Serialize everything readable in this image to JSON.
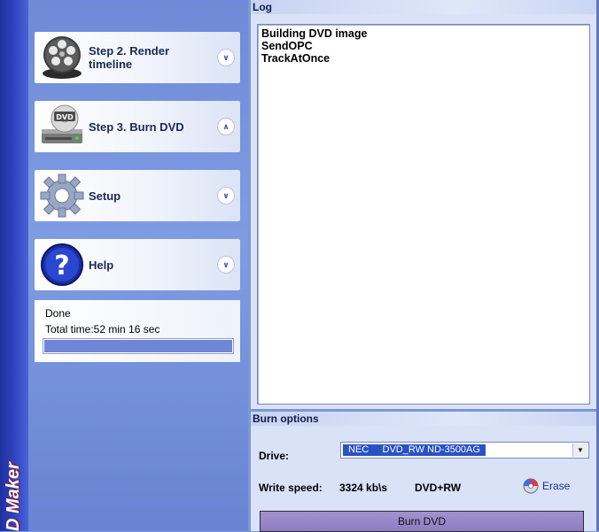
{
  "brand": {
    "text": "D Maker"
  },
  "steps": [
    {
      "label": "Step 2. Render timeline",
      "icon": "film-reel-icon",
      "state": "collapsed"
    },
    {
      "label": "Step 3. Burn DVD",
      "icon": "dvd-drive-icon",
      "state": "expanded",
      "icon_text": "DVD"
    },
    {
      "label": "Setup",
      "icon": "gear-icon",
      "state": "collapsed"
    },
    {
      "label": "Help",
      "icon": "help-icon",
      "state": "collapsed",
      "icon_text": "?"
    }
  ],
  "status": {
    "state": "Done",
    "total_time": "Total time:52 min 16 sec",
    "progress": 1.0
  },
  "log": {
    "title": "Log",
    "lines": [
      "Building DVD image",
      "SendOPC",
      "TrackAtOnce"
    ]
  },
  "burn_options": {
    "title": "Burn options",
    "drive_label": "Drive:",
    "drive_value": "NEC     DVD_RW ND-3500AG",
    "write_speed_label": "Write speed:",
    "write_speed_value": "3324 kb\\s",
    "media_type": "DVD+RW",
    "erase_label": "Erase",
    "burn_button_label": "Burn DVD"
  },
  "colors": {
    "pane_background": "#7d97d6",
    "brand_strip": "#2a3db8",
    "selection_highlight": "#2a52c4",
    "burn_button": "#9686c8"
  }
}
